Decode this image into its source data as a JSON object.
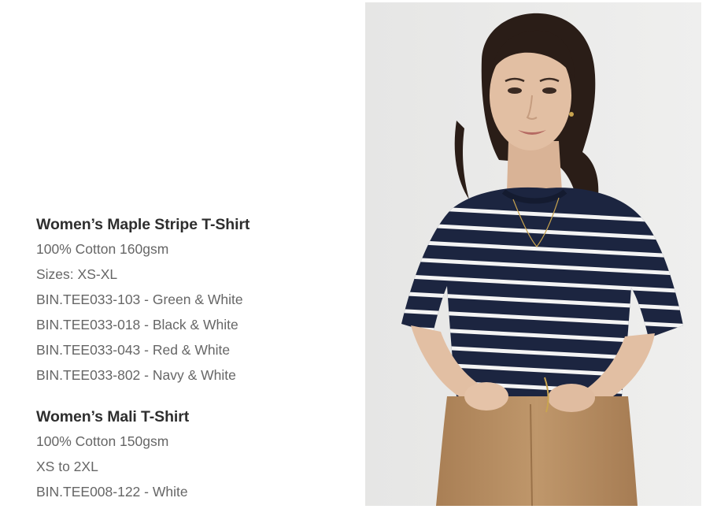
{
  "products": [
    {
      "title": "Women’s Maple Stripe T-Shirt",
      "lines": [
        "100% Cotton 160gsm",
        "Sizes: XS-XL",
        "BIN.TEE033-103 - Green & White",
        "BIN.TEE033-018 - Black & White",
        "BIN.TEE033-043 - Red & White",
        "BIN.TEE033-802 - Navy & White"
      ]
    },
    {
      "title": "Women’s Mali T-Shirt",
      "lines": [
        "100% Cotton 150gsm",
        "XS to 2XL",
        "BIN.TEE008-122 - White"
      ]
    }
  ],
  "photo": {
    "icon": "model-photo",
    "colors": {
      "background": "#e9e9e8",
      "shirt_navy": "#1c2540",
      "stripe_white": "#f4f4f4",
      "skirt_tan": "#b88e62",
      "skin": "#e2bfa3",
      "hair": "#2a1d17"
    }
  }
}
